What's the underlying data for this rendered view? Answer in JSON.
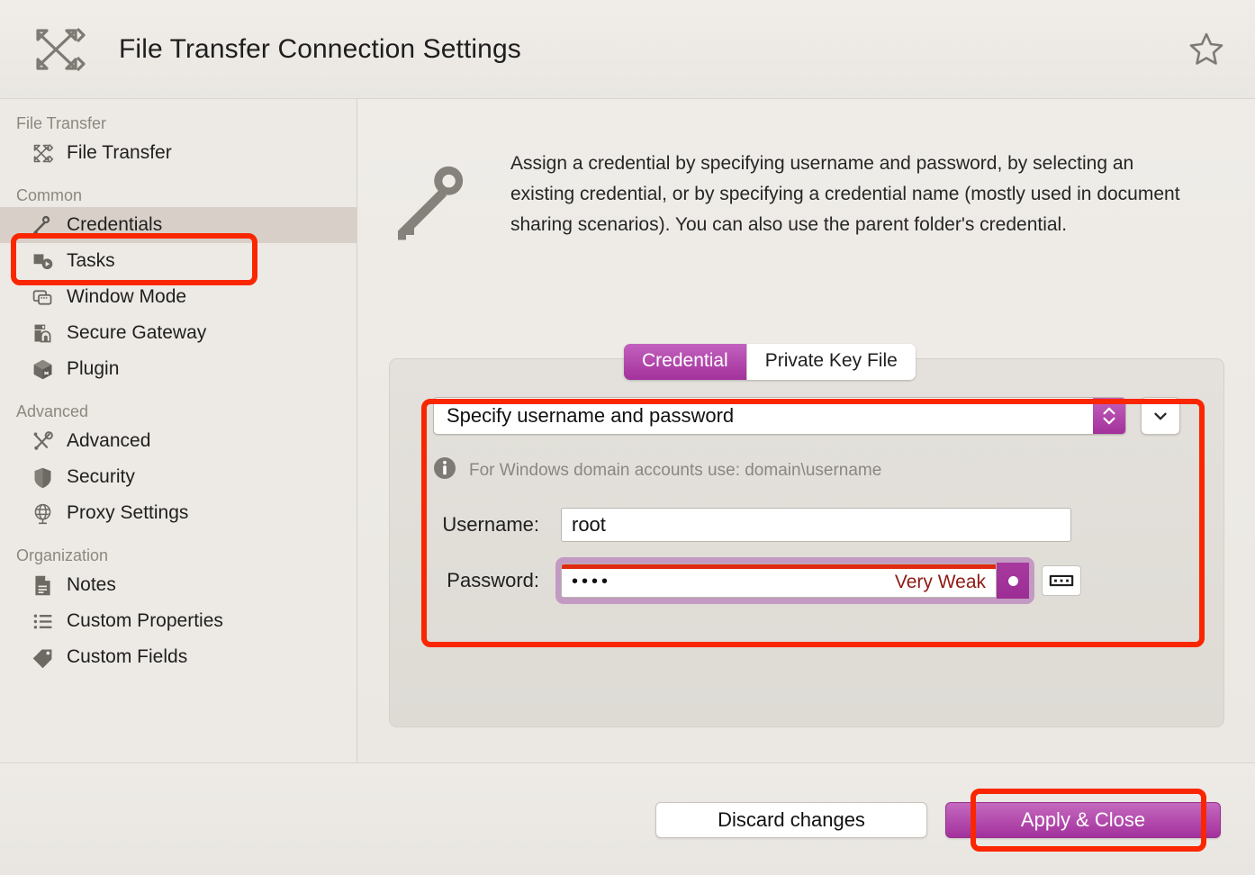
{
  "header": {
    "title": "File Transfer Connection Settings",
    "logo_icon": "file-transfer-logo-icon",
    "star_icon": "favorite-star-icon"
  },
  "sidebar": {
    "groups": [
      {
        "title": "File Transfer",
        "items": [
          {
            "label": "File Transfer",
            "icon": "file-transfer-icon",
            "selected": false
          }
        ]
      },
      {
        "title": "Common",
        "items": [
          {
            "label": "Credentials",
            "icon": "key-icon",
            "selected": true
          },
          {
            "label": "Tasks",
            "icon": "tasks-icon",
            "selected": false
          },
          {
            "label": "Window Mode",
            "icon": "window-mode-icon",
            "selected": false
          },
          {
            "label": "Secure Gateway",
            "icon": "secure-gateway-icon",
            "selected": false
          },
          {
            "label": "Plugin",
            "icon": "plugin-icon",
            "selected": false
          }
        ]
      },
      {
        "title": "Advanced",
        "items": [
          {
            "label": "Advanced",
            "icon": "tools-icon",
            "selected": false
          },
          {
            "label": "Security",
            "icon": "shield-icon",
            "selected": false
          },
          {
            "label": "Proxy Settings",
            "icon": "globe-icon",
            "selected": false
          }
        ]
      },
      {
        "title": "Organization",
        "items": [
          {
            "label": "Notes",
            "icon": "document-icon",
            "selected": false
          },
          {
            "label": "Custom Properties",
            "icon": "list-icon",
            "selected": false
          },
          {
            "label": "Custom Fields",
            "icon": "tag-icon",
            "selected": false
          }
        ]
      }
    ]
  },
  "main": {
    "intro_icon": "key-large-icon",
    "intro_text": "Assign a credential by specifying username and password, by selecting an existing credential, or by specifying a credential name (mostly used in document sharing scenarios). You can also use the parent folder's credential.",
    "tabs": [
      {
        "label": "Credential",
        "active": true
      },
      {
        "label": "Private Key File",
        "active": false
      }
    ],
    "credential_mode": {
      "selected": "Specify username and password",
      "stepper_icon": "stepper-up-down-icon",
      "dropdown_icon": "chevron-down-icon"
    },
    "hint": {
      "icon": "info-icon",
      "text": "For Windows domain accounts use: domain\\username"
    },
    "fields": {
      "username_label": "Username:",
      "username_value": "root",
      "username_placeholder": "",
      "password_label": "Password:",
      "password_value": "••••",
      "password_placeholder": "",
      "password_strength": "Very Weak",
      "reveal_icon": "reveal-password-dot-icon",
      "keyboard_icon": "virtual-keyboard-icon"
    }
  },
  "footer": {
    "discard_label": "Discard changes",
    "apply_label": "Apply & Close"
  },
  "colors": {
    "accent_purple": "#a3319c",
    "accent_purple_light": "#c569bf",
    "highlight_red": "#fa2600",
    "strength_red": "#e02a10",
    "strength_text": "#8e1a14",
    "window_bg": "#ece9e4",
    "sidebar_bg": "#edeae5",
    "selected_row": "#d8d0c8",
    "panel_bg": "#e2dfda"
  },
  "annotations": [
    {
      "name": "credentials-nav-highlight"
    },
    {
      "name": "credential-fields-highlight"
    },
    {
      "name": "apply-close-highlight"
    }
  ]
}
